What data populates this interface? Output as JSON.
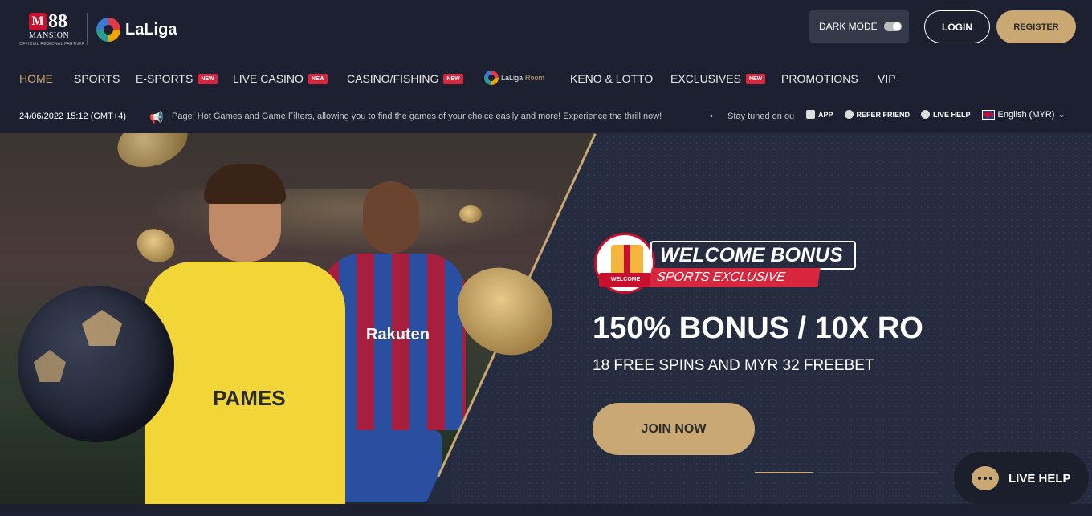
{
  "brand": {
    "m88_badge": "M",
    "m88_num": "88",
    "m88_name": "MANSION",
    "m88_tagline": "OFFICIAL REGIONAL PARTNER",
    "laliga": "LaLiga"
  },
  "header": {
    "dark_mode_label": "DARK MODE",
    "login_label": "LOGIN",
    "register_label": "REGISTER"
  },
  "nav": {
    "items": [
      {
        "label": "HOME",
        "active": true
      },
      {
        "label": "SPORTS"
      },
      {
        "label": "E-SPORTS",
        "badge": "NEW"
      },
      {
        "label": "LIVE CASINO",
        "badge": "NEW"
      },
      {
        "label": "CASINO/FISHING",
        "badge": "NEW"
      },
      {
        "label": "LaLiga",
        "sub": "Room"
      },
      {
        "label": "KENO & LOTTO"
      },
      {
        "label": "EXCLUSIVES",
        "badge": "NEW"
      },
      {
        "label": "PROMOTIONS"
      },
      {
        "label": "VIP"
      }
    ]
  },
  "ticker": {
    "datetime": "24/06/2022 15:12 (GMT+4)",
    "message": "Page: Hot Games and Game Filters, allowing you to find the games of your choice easily and more! Experience the thrill now!",
    "dot": "•",
    "message2": "Stay tuned on ou",
    "links": {
      "app": "APP",
      "refer": "REFER FRIEND",
      "live_help": "LIVE HELP",
      "language": "English (MYR)"
    }
  },
  "hero": {
    "yellow_text": "PAMES",
    "red_text": "Rakuten",
    "welcome_ribbon": "WELCOME",
    "welcome_title": "WELCOME BONUS",
    "sports_exclusive": "SPORTS EXCLUSIVE",
    "headline": "150% BONUS / 10X RO",
    "subhead": "18 FREE SPINS AND MYR 32 FREEBET",
    "cta": "JOIN NOW"
  },
  "live_help": {
    "label": "LIVE HELP"
  },
  "colors": {
    "accent_gold": "#c9a874",
    "badge_red": "#d7263d",
    "background": "#1c2030"
  }
}
